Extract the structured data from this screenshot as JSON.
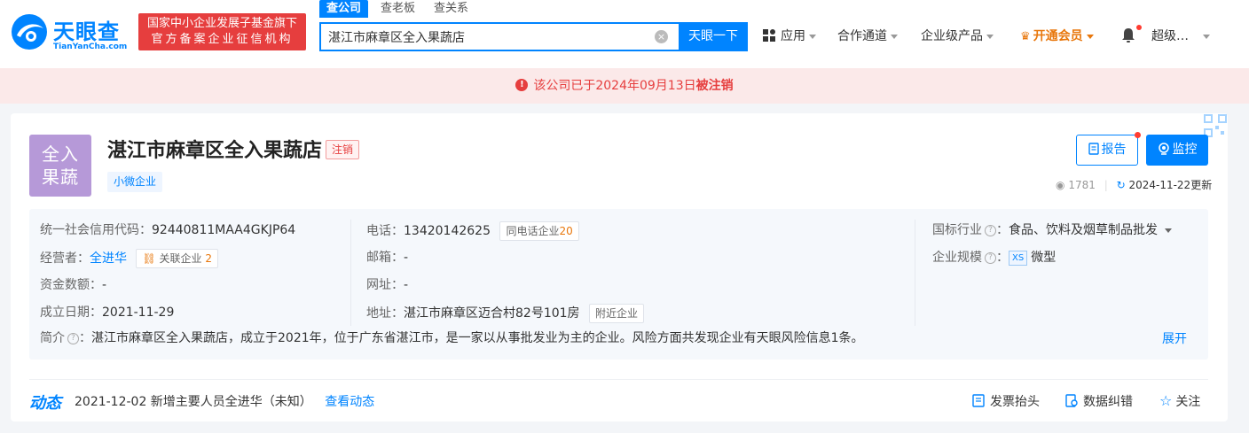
{
  "header": {
    "logo_cn": "天眼查",
    "logo_en": "TianYanCha.com",
    "badge_line1": "国家中小企业发展子基金旗下",
    "badge_line2": "官方备案企业征信机构",
    "search_tabs": [
      "查公司",
      "查老板",
      "查关系"
    ],
    "search_value": "湛江市麻章区全入果蔬店",
    "search_button": "天眼一下",
    "nav": {
      "apps": "应用",
      "partner": "合作通道",
      "enterprise": "企业级产品",
      "vip": "开通会员",
      "user": "超级…"
    }
  },
  "notice": {
    "prefix": "该公司已于2024年09月13日",
    "emph": "被注销"
  },
  "company": {
    "avatar_line1": "全入",
    "avatar_line2": "果蔬",
    "name": "湛江市麻章区全入果蔬店",
    "status": "注销",
    "type": "小微企业",
    "report_label": "报告",
    "monitor_label": "监控",
    "views": "1781",
    "updated": "2024-11-22更新"
  },
  "info": {
    "credit_code_label": "统一社会信用代码：",
    "credit_code": "92440811MAA4GKJP64",
    "operator_label": "经营者：",
    "operator": "全进华",
    "related_label": "关联企业",
    "related_count": "2",
    "capital_label": "资金数额：",
    "capital": "-",
    "founded_label": "成立日期：",
    "founded": "2021-11-29",
    "phone_label": "电话：",
    "phone": "13420142625",
    "same_phone_label": "同电话企业",
    "same_phone_count": "20",
    "email_label": "邮箱：",
    "email": "-",
    "website_label": "网址：",
    "website": "-",
    "address_label": "地址：",
    "address": "湛江市麻章区迈合村82号101房",
    "nearby_label": "附近企业",
    "industry_label": "国标行业",
    "industry": "食品、饮料及烟草制品批发",
    "scale_label": "企业规模",
    "scale_badge": "XS",
    "scale": "微型",
    "intro_label": "简介",
    "intro": "湛江市麻章区全入果蔬店，成立于2021年，位于广东省湛江市，是一家以从事批发业为主的企业。风险方面共发现企业有天眼风险信息1条。",
    "expand": "展开"
  },
  "dynamic": {
    "title": "动态",
    "text": "2021-12-02 新增主要人员全进华（未知）",
    "link": "查看动态",
    "invoice": "发票抬头",
    "correction": "数据纠错",
    "follow": "关注"
  },
  "colors": {
    "brand": "#0084ff",
    "danger": "#e63e3e",
    "vip": "#e8770c",
    "avatar": "#b699d8"
  }
}
